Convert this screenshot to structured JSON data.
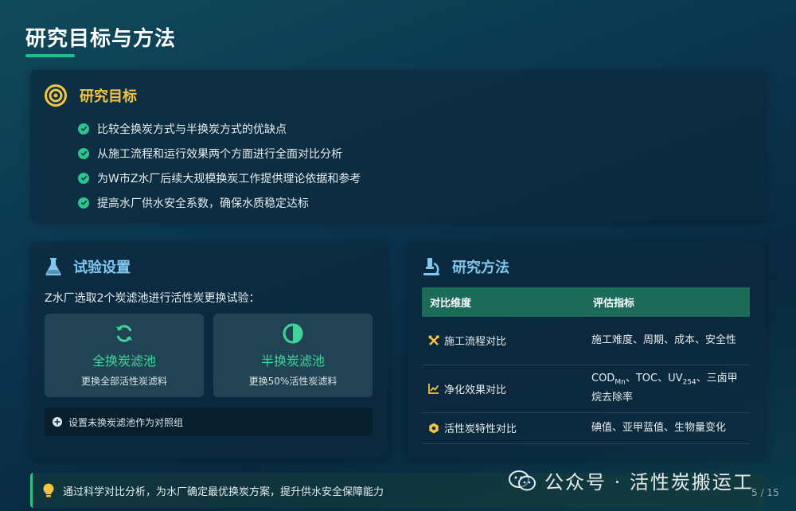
{
  "page_title": "研究目标与方法",
  "goals": {
    "title": "研究目标",
    "items": [
      "比较全换炭方式与半换炭方式的优缺点",
      "从施工流程和运行效果两个方面进行全面对比分析",
      "为W市Z水厂后续大规模换炭工作提供理论依据和参考",
      "提高水厂供水安全系数，确保水质稳定达标"
    ]
  },
  "experiment": {
    "title": "试验设置",
    "intro": "Z水厂选取2个炭滤池进行活性炭更换试验：",
    "options": [
      {
        "title": "全换炭滤池",
        "desc": "更换全部活性炭滤料"
      },
      {
        "title": "半换炭滤池",
        "desc": "更换50%活性炭滤料"
      }
    ],
    "note": "设置未换炭滤池作为对照组"
  },
  "methods": {
    "title": "研究方法",
    "headers": [
      "对比维度",
      "评估指标"
    ],
    "rows": [
      {
        "dimension": "施工流程对比",
        "metric": "施工难度、周期、成本、安全性"
      },
      {
        "dimension": "净化效果对比",
        "metric_parts": [
          "COD",
          "Mn",
          "、TOC、UV",
          "254",
          "、三卤甲烷去除率"
        ]
      },
      {
        "dimension": "活性炭特性对比",
        "metric": "碘值、亚甲蓝值、生物量变化"
      }
    ]
  },
  "tip": "通过科学对比分析，为水厂确定最优换炭方案，提升供水安全保障能力",
  "watermark": "公众号 · 活性炭搬运工",
  "page_number": "5 / 15",
  "colors": {
    "accent_green": "#2bc48a",
    "goal_title": "#f5c542",
    "section_title": "#7fc8ef",
    "table_header": "#1b6b58"
  }
}
